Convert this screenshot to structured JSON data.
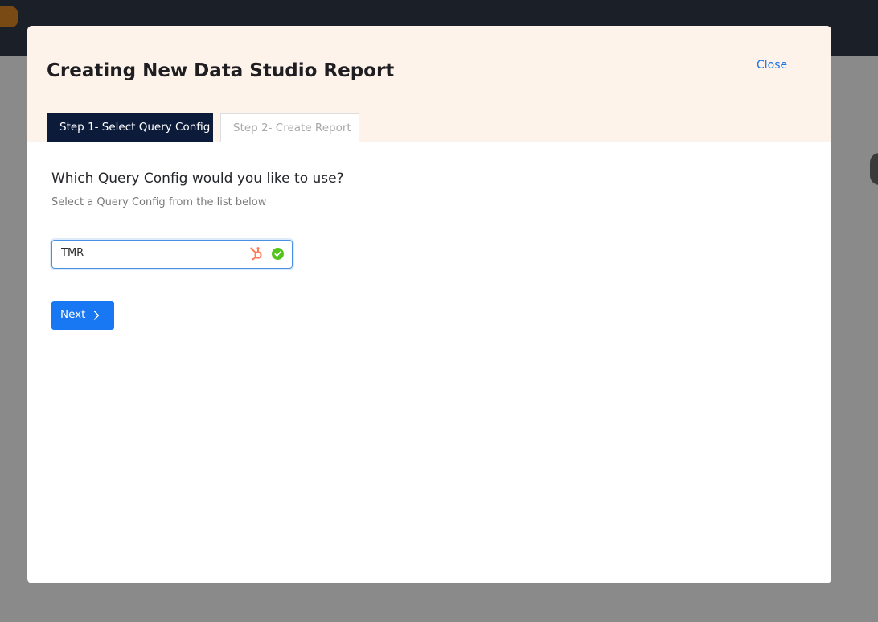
{
  "modal": {
    "title": "Creating New Data Studio Report",
    "close_label": "Close"
  },
  "tabs": [
    {
      "label": "Step 1- Select Query Config",
      "active": true
    },
    {
      "label": "Step 2- Create Report",
      "active": false
    }
  ],
  "step1": {
    "question": "Which Query Config would you like to use?",
    "subtext": "Select a Query Config from the list below",
    "select": {
      "value": "TMR",
      "source_icon": "hubspot-icon",
      "status_icon": "check-circle-icon"
    },
    "next_label": "Next"
  },
  "colors": {
    "header_bg": "#fef3ea",
    "active_tab_bg": "#0d1b3a",
    "primary": "#1877f2",
    "link": "#1a73e8",
    "hubspot": "#ff7a59",
    "success": "#52c41a"
  }
}
